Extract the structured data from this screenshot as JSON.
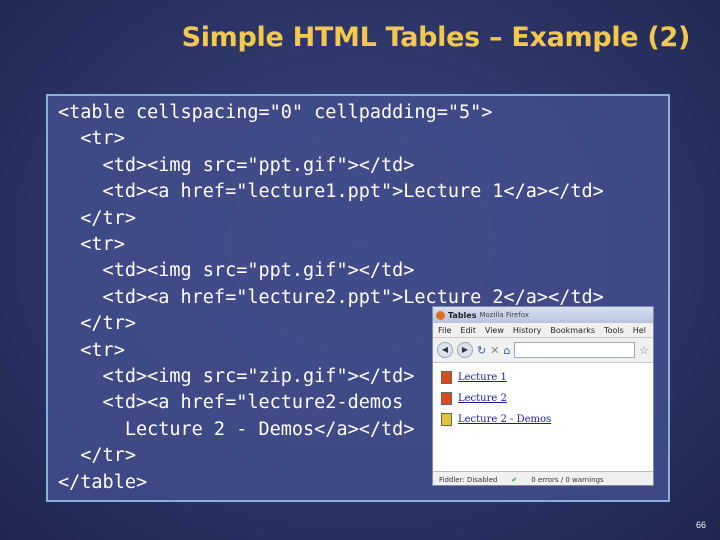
{
  "slide": {
    "title": "Simple HTML Tables – Example (2)",
    "page_number": "66"
  },
  "code_lines": [
    "<table cellspacing=\"0\" cellpadding=\"5\">",
    "  <tr>",
    "    <td><img src=\"ppt.gif\"></td>",
    "    <td><a href=\"lecture1.ppt\">Lecture 1</a></td>",
    "  </tr>",
    "  <tr>",
    "    <td><img src=\"ppt.gif\"></td>",
    "    <td><a href=\"lecture2.ppt\">Lecture 2</a></td>",
    "  </tr>",
    "  <tr>",
    "    <td><img src=\"zip.gif\"></td>",
    "    <td><a href=\"lecture2-demos",
    "      Lecture 2 - Demos</a></td>",
    "  </tr>",
    "</table>"
  ],
  "browser": {
    "title": "Tables",
    "app_name": "Mozilla Firefox",
    "menu": [
      "File",
      "Edit",
      "View",
      "History",
      "Bookmarks",
      "Tools",
      "Hel"
    ],
    "links": [
      {
        "label": "Lecture 1",
        "icon": "ppt-icon"
      },
      {
        "label": "Lecture 2",
        "icon": "ppt-icon"
      },
      {
        "label": "Lecture 2 - Demos",
        "icon": "zip-icon"
      }
    ],
    "status_left": "Fiddler: Disabled",
    "status_right": "0 errors / 0 warnings"
  }
}
